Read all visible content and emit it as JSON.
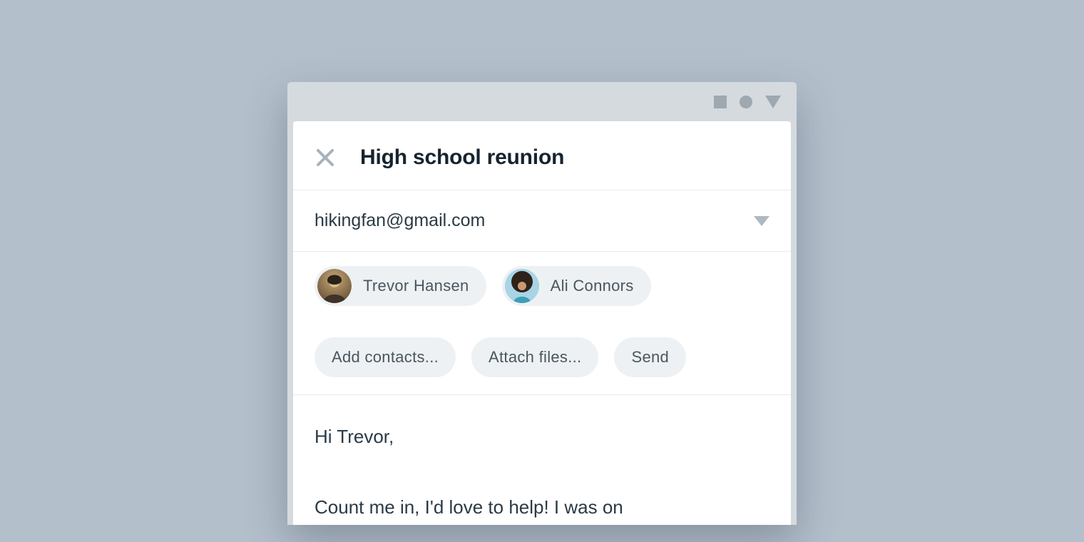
{
  "window": {
    "icons": {
      "square": "square-icon",
      "circle": "circle-icon",
      "triangle": "triangle-down-icon"
    }
  },
  "compose": {
    "subject": "High school reunion",
    "from": "hikingfan@gmail.com",
    "recipients": [
      {
        "name": "Trevor Hansen",
        "avatar_colors": [
          "#8a6d4a",
          "#c7a875"
        ]
      },
      {
        "name": "Ali Connors",
        "avatar_colors": [
          "#8fc8e0",
          "#2c2320"
        ]
      }
    ],
    "actions": {
      "add_contacts": "Add contacts...",
      "attach_files": "Attach files...",
      "send": "Send"
    },
    "body": "Hi Trevor,\n\nCount me in, I'd love to help! I was on"
  }
}
